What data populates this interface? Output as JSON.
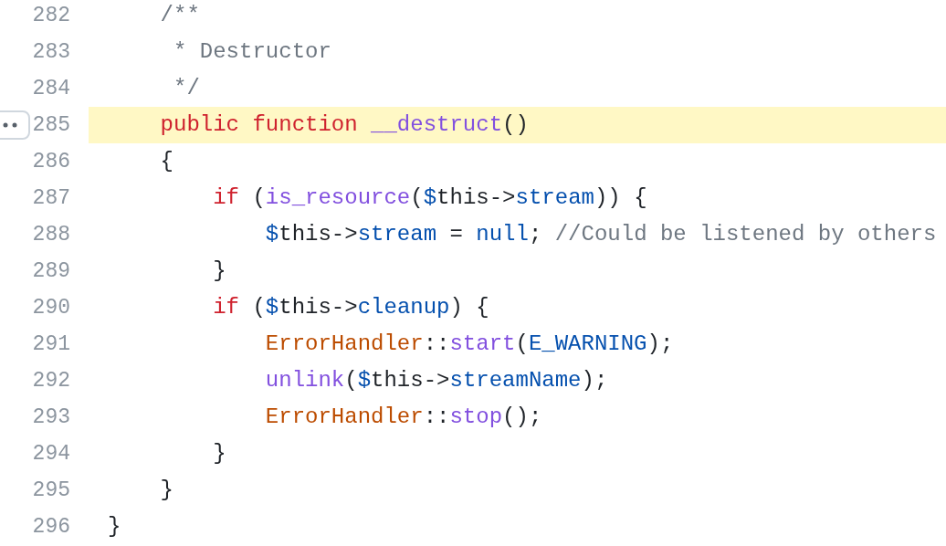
{
  "code_view": {
    "lines": [
      {
        "number": "282",
        "highlighted": false,
        "menu_button": false,
        "tokens": [
          {
            "kind": "comment",
            "text": "    /**"
          }
        ]
      },
      {
        "number": "283",
        "highlighted": false,
        "menu_button": false,
        "tokens": [
          {
            "kind": "comment",
            "text": "     * Destructor"
          }
        ]
      },
      {
        "number": "284",
        "highlighted": false,
        "menu_button": false,
        "tokens": [
          {
            "kind": "comment",
            "text": "     */"
          }
        ]
      },
      {
        "number": "285",
        "highlighted": true,
        "menu_button": true,
        "tokens": [
          {
            "kind": "keyword",
            "text": "    public function "
          },
          {
            "kind": "function",
            "text": "__destruct"
          },
          {
            "kind": "plain",
            "text": "()"
          }
        ]
      },
      {
        "number": "286",
        "highlighted": false,
        "menu_button": false,
        "tokens": [
          {
            "kind": "plain",
            "text": "    {"
          }
        ]
      },
      {
        "number": "287",
        "highlighted": false,
        "menu_button": false,
        "tokens": [
          {
            "kind": "keyword",
            "text": "        if"
          },
          {
            "kind": "plain",
            "text": " ("
          },
          {
            "kind": "function",
            "text": "is_resource"
          },
          {
            "kind": "plain",
            "text": "("
          },
          {
            "kind": "variable",
            "text": "$"
          },
          {
            "kind": "plain",
            "text": "this->"
          },
          {
            "kind": "variable",
            "text": "stream"
          },
          {
            "kind": "plain",
            "text": ")) {"
          }
        ]
      },
      {
        "number": "288",
        "highlighted": false,
        "menu_button": false,
        "tokens": [
          {
            "kind": "variable",
            "text": "            $"
          },
          {
            "kind": "plain",
            "text": "this->"
          },
          {
            "kind": "variable",
            "text": "stream"
          },
          {
            "kind": "plain",
            "text": " = "
          },
          {
            "kind": "variable",
            "text": "null"
          },
          {
            "kind": "plain",
            "text": ";"
          },
          {
            "kind": "comment",
            "text": " //Could be listened by others"
          }
        ]
      },
      {
        "number": "289",
        "highlighted": false,
        "menu_button": false,
        "tokens": [
          {
            "kind": "plain",
            "text": "        }"
          }
        ]
      },
      {
        "number": "290",
        "highlighted": false,
        "menu_button": false,
        "tokens": [
          {
            "kind": "keyword",
            "text": "        if"
          },
          {
            "kind": "plain",
            "text": " ("
          },
          {
            "kind": "variable",
            "text": "$"
          },
          {
            "kind": "plain",
            "text": "this->"
          },
          {
            "kind": "variable",
            "text": "cleanup"
          },
          {
            "kind": "plain",
            "text": ") {"
          }
        ]
      },
      {
        "number": "291",
        "highlighted": false,
        "menu_button": false,
        "tokens": [
          {
            "kind": "class",
            "text": "            ErrorHandler"
          },
          {
            "kind": "plain",
            "text": "::"
          },
          {
            "kind": "function",
            "text": "start"
          },
          {
            "kind": "plain",
            "text": "("
          },
          {
            "kind": "variable",
            "text": "E_WARNING"
          },
          {
            "kind": "plain",
            "text": ");"
          }
        ]
      },
      {
        "number": "292",
        "highlighted": false,
        "menu_button": false,
        "tokens": [
          {
            "kind": "function",
            "text": "            unlink"
          },
          {
            "kind": "plain",
            "text": "("
          },
          {
            "kind": "variable",
            "text": "$"
          },
          {
            "kind": "plain",
            "text": "this->"
          },
          {
            "kind": "variable",
            "text": "streamName"
          },
          {
            "kind": "plain",
            "text": ");"
          }
        ]
      },
      {
        "number": "293",
        "highlighted": false,
        "menu_button": false,
        "tokens": [
          {
            "kind": "class",
            "text": "            ErrorHandler"
          },
          {
            "kind": "plain",
            "text": "::"
          },
          {
            "kind": "function",
            "text": "stop"
          },
          {
            "kind": "plain",
            "text": "();"
          }
        ]
      },
      {
        "number": "294",
        "highlighted": false,
        "menu_button": false,
        "tokens": [
          {
            "kind": "plain",
            "text": "        }"
          }
        ]
      },
      {
        "number": "295",
        "highlighted": false,
        "menu_button": false,
        "tokens": [
          {
            "kind": "plain",
            "text": "    }"
          }
        ]
      },
      {
        "number": "296",
        "highlighted": false,
        "menu_button": false,
        "tokens": [
          {
            "kind": "plain",
            "text": "}"
          }
        ]
      }
    ]
  }
}
